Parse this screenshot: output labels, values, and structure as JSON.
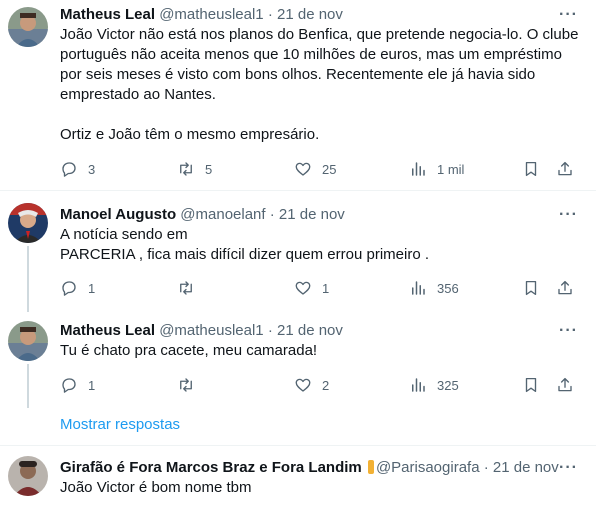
{
  "tweets": [
    {
      "name": "Matheus Leal",
      "handle": "@matheusleal1",
      "dot": "·",
      "date": "21 de nov",
      "text": "João Victor não está nos planos do Benfica, que pretende negocia-lo. O clube português não aceita menos que 10 milhões de euros, mas um empréstimo por seis meses é visto com bons olhos. Recentemente ele já havia sido emprestado ao Nantes.\n\nOrtiz e João têm o mesmo empresário.",
      "replies": "3",
      "retweets": "5",
      "likes": "25",
      "views": "1 mil"
    },
    {
      "name": "Manoel Augusto",
      "handle": "@manoelanf",
      "dot": "·",
      "date": "21 de nov",
      "text": "A notícia sendo em\nPARCERIA , fica mais difícil dizer quem errou primeiro .",
      "replies": "1",
      "retweets": "",
      "likes": "1",
      "views": "356"
    },
    {
      "name": "Matheus Leal",
      "handle": "@matheusleal1",
      "dot": "·",
      "date": "21 de nov",
      "text": "Tu é chato pra cacete, meu camarada!",
      "replies": "1",
      "retweets": "",
      "likes": "2",
      "views": "325"
    },
    {
      "name": "Girafão é Fora Marcos Braz e Fora Landim",
      "handle": "@Parisaogirafa",
      "dot": "·",
      "date": "21 de nov",
      "text": "João Victor é bom nome tbm"
    }
  ],
  "show_replies": "Mostrar respostas",
  "more_glyph": "···",
  "icons": [
    "reply-icon",
    "retweet-icon",
    "like-icon",
    "views-icon",
    "bookmark-icon",
    "share-icon"
  ],
  "colors": {
    "link": "#1d9bf0",
    "muted": "#536471",
    "text": "#0f1419",
    "thread_line": "#cfd9de"
  }
}
